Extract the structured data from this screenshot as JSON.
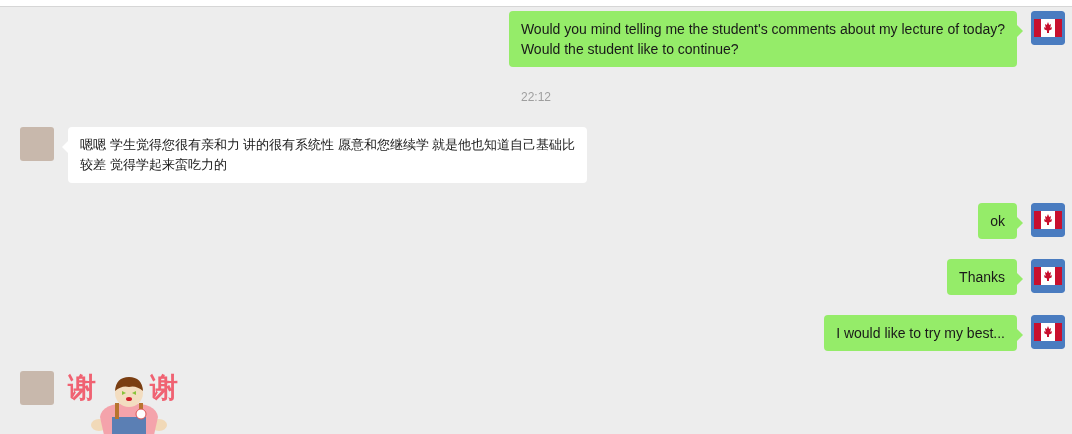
{
  "messages": [
    {
      "kind": "sent",
      "lines": [
        "Would you mind telling me the student's comments about my lecture of today?",
        "Would the student like to continue?"
      ]
    },
    {
      "kind": "time",
      "text": "22:12"
    },
    {
      "kind": "received",
      "lines": [
        "嗯嗯 学生觉得您很有亲和力 讲的很有系统性 愿意和您继续学 就是他也知道自己基础比",
        "较差 觉得学起来蛮吃力的"
      ]
    },
    {
      "kind": "sent",
      "lines": [
        "ok"
      ]
    },
    {
      "kind": "sent",
      "lines": [
        "Thanks"
      ]
    },
    {
      "kind": "sent",
      "lines": [
        "I would like to try my best..."
      ]
    },
    {
      "kind": "sticker",
      "left_text": "谢",
      "right_text": "谢"
    }
  ]
}
